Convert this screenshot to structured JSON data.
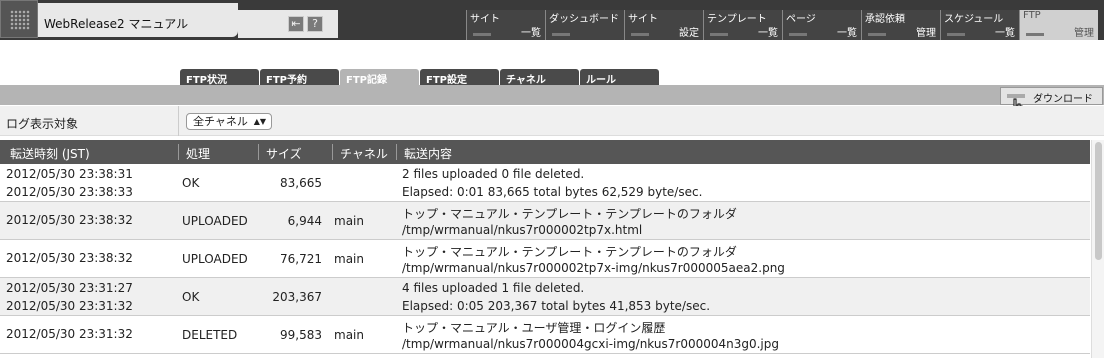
{
  "app": {
    "title": "WebRelease2 マニュアル",
    "buttons": [
      "⇤",
      "?"
    ]
  },
  "nav": [
    {
      "line1": "サイト",
      "line2": "一覧"
    },
    {
      "line1": "ダッシュボード",
      "line2": ""
    },
    {
      "line1": "サイト",
      "line2": "設定"
    },
    {
      "line1": "テンプレート",
      "line2": "一覧"
    },
    {
      "line1": "ページ",
      "line2": "一覧"
    },
    {
      "line1": "承認依頼",
      "line2": "管理"
    },
    {
      "line1": "スケジュール",
      "line2": "一覧"
    },
    {
      "line1": "FTP",
      "line2": "管理"
    }
  ],
  "tabs": [
    "FTP状況",
    "FTP予約",
    "FTP記録",
    "FTP設定",
    "チャネル",
    "ルール"
  ],
  "toolbar": {
    "download_label": "ダウンロード"
  },
  "filter": {
    "label": "ログ表示対象",
    "selected": "全チャネル"
  },
  "table": {
    "headers": [
      "転送時刻 (JST)",
      "処理",
      "サイズ",
      "チャネル",
      "転送内容"
    ],
    "rows": [
      {
        "time1": "2012/05/30 23:38:31",
        "time2": "2012/05/30 23:38:33",
        "action": "OK",
        "size": "83,665",
        "channel": "",
        "content1": "2 files uploaded   0 file deleted.",
        "content2": "Elapsed: 0:01   83,665 total bytes   62,529 byte/sec."
      },
      {
        "time1": "2012/05/30 23:38:32",
        "time2": "",
        "action": "UPLOADED",
        "size": "6,944",
        "channel": "main",
        "content1": "トップ・マニュアル・テンプレート・テンプレートのフォルダ",
        "content2": "/tmp/wrmanual/nkus7r000002tp7x.html"
      },
      {
        "time1": "2012/05/30 23:38:32",
        "time2": "",
        "action": "UPLOADED",
        "size": "76,721",
        "channel": "main",
        "content1": "トップ・マニュアル・テンプレート・テンプレートのフォルダ",
        "content2": "/tmp/wrmanual/nkus7r000002tp7x-img/nkus7r000005aea2.png"
      },
      {
        "time1": "2012/05/30 23:31:27",
        "time2": "2012/05/30 23:31:32",
        "action": "OK",
        "size": "203,367",
        "channel": "",
        "content1": "4 files uploaded   1 file deleted.",
        "content2": "Elapsed: 0:05   203,367 total bytes   41,853 byte/sec."
      },
      {
        "time1": "2012/05/30 23:31:32",
        "time2": "",
        "action": "DELETED",
        "size": "99,583",
        "channel": "main",
        "content1": "トップ・マニュアル・ユーザ管理・ログイン履歴",
        "content2": "/tmp/wrmanual/nkus7r000004gcxi-img/nkus7r000004n3g0.jpg"
      }
    ]
  },
  "colors": {
    "topbar": "#3a3a3a",
    "header": "#565656",
    "active_tab": "#b4b4b4"
  }
}
